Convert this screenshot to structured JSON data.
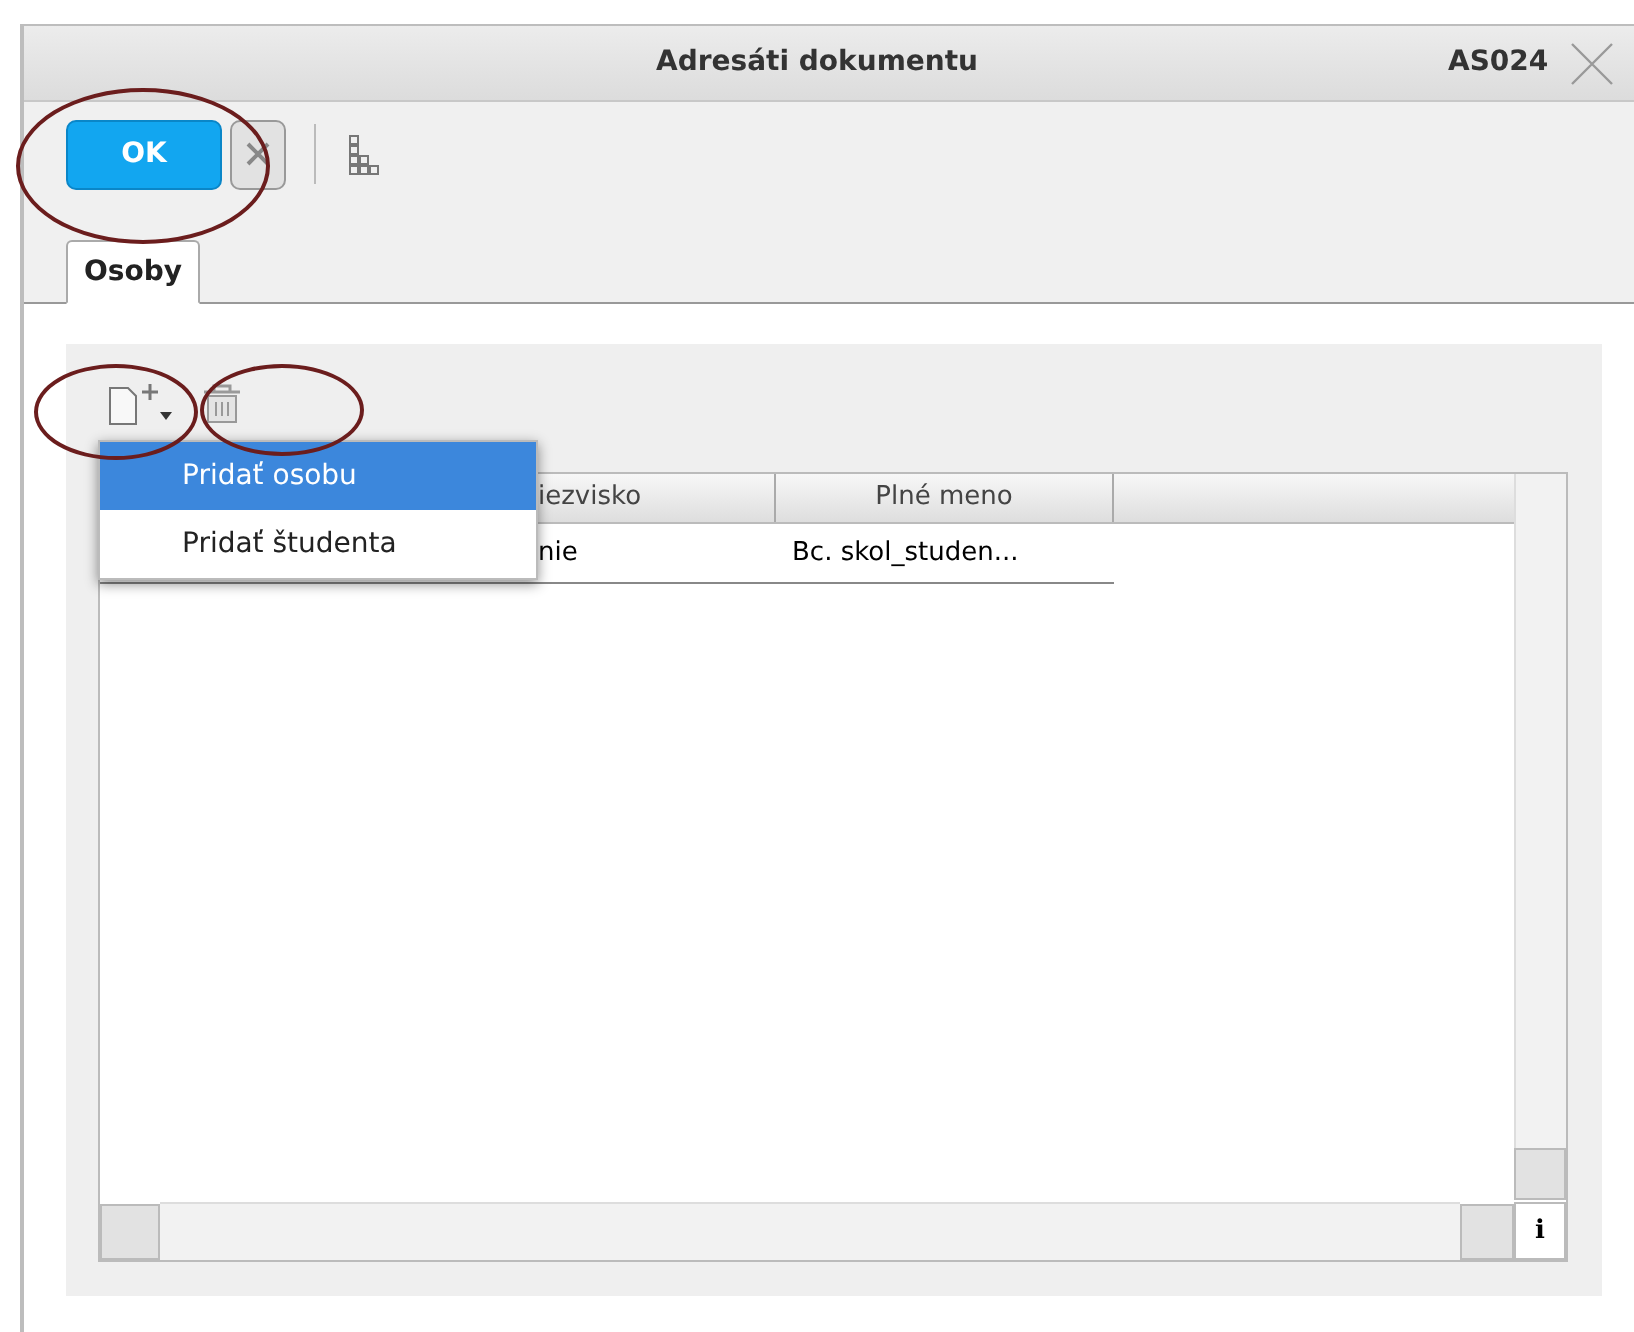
{
  "window": {
    "title": "Adresáti dokumentu",
    "code": "AS024"
  },
  "toolbar": {
    "ok_label": "OK"
  },
  "tabs": [
    {
      "label": "Osoby",
      "selected": true
    }
  ],
  "add_menu": {
    "items": [
      {
        "label": "Pridať osobu",
        "selected": true
      },
      {
        "label": "Pridať študenta",
        "selected": false
      }
    ]
  },
  "table": {
    "columns": [
      "iezvisko",
      "Plné meno"
    ],
    "rows": [
      [
        "nie",
        "Bc. skol_studen..."
      ]
    ]
  },
  "info_label": "i"
}
